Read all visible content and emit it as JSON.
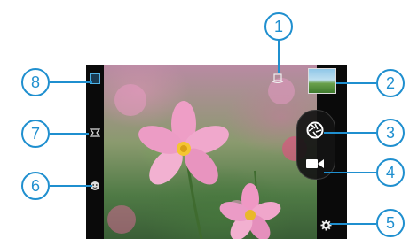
{
  "callouts": [
    {
      "n": "1",
      "target": "rotate-icon"
    },
    {
      "n": "2",
      "target": "gallery-thumbnail"
    },
    {
      "n": "3",
      "target": "shutter-button"
    },
    {
      "n": "4",
      "target": "video-record-button"
    },
    {
      "n": "5",
      "target": "settings-icon"
    },
    {
      "n": "6",
      "target": "face-detection-icon"
    },
    {
      "n": "7",
      "target": "panorama-icon"
    },
    {
      "n": "8",
      "target": "camera-mode-icon"
    }
  ],
  "colors": {
    "accent": "#1f8fcf",
    "bar": "#0a0a0a"
  }
}
